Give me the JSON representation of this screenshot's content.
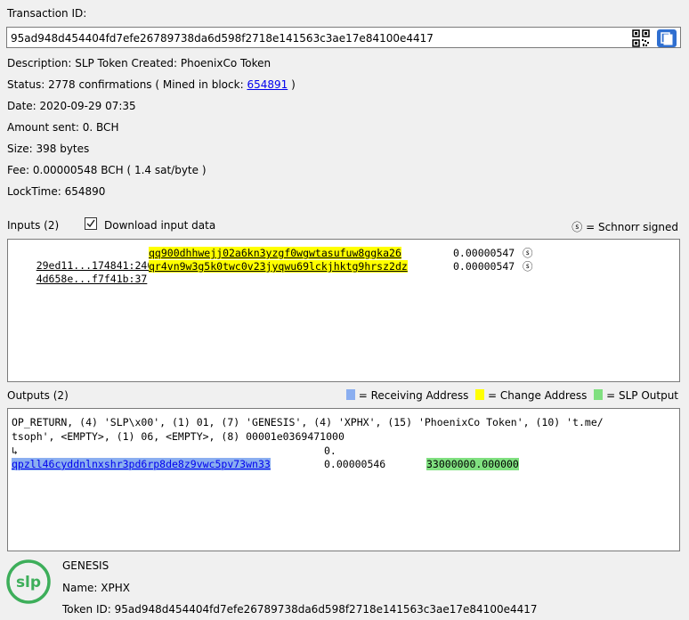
{
  "transaction": {
    "id_label": "Transaction ID:",
    "id_value": "95ad948d454404fd7efe26789738da6d598f2718e141563c3ae17e84100e4417",
    "description": "Description: SLP Token Created: PhoenixCo Token",
    "status_prefix": "Status: 2778 confirmations ( Mined in block: ",
    "block_link": "654891",
    "status_suffix": " )",
    "date": "Date: 2020-09-29 07:35",
    "amount": "Amount sent: 0. BCH",
    "size": "Size: 398 bytes",
    "fee": "Fee: 0.00000548 BCH ( 1.4 sat/byte )",
    "locktime": "LockTime: 654890"
  },
  "inputs": {
    "title": "Inputs (2)",
    "download_label": "Download input data",
    "download_checked": true,
    "schnorr_legend": "= Schnorr signed",
    "schnorr_symbol": "ⓢ",
    "rows": [
      {
        "outpoint": "29ed11...174841:240",
        "address": "qq900dhhwejj02a6kn3yzgf0wgwtasufuw8ggka26",
        "amount": "0.00000547",
        "sig": "ⓢ"
      },
      {
        "outpoint": "4d658e...f7f41b:37",
        "address": "qr4vn9w3g5k0twc0v23jyqwu69lckjhktg9hrsz2dz",
        "amount": "0.00000547",
        "sig": "ⓢ"
      }
    ]
  },
  "outputs": {
    "title": "Outputs (2)",
    "legend_receiving": "= Receiving Address",
    "legend_change": "= Change Address",
    "legend_slp": "= SLP Output",
    "op_return_line1": "OP_RETURN, (4) 'SLP\\x00', (1) 01, (7) 'GENESIS', (4) 'XPHX', (15) 'PhoenixCo Token', (10) 't.me/",
    "op_return_line2": "tsoph', <EMPTY>, (1) 06, <EMPTY>, (8) 00001e0369471000",
    "op_return_line3_symbol": "↳",
    "op_return_amount": "0.",
    "address": "qpzll46cyddnlnxshr3pd6rp8de8z9vwc5pv73wn33",
    "amount": "0.00000546",
    "slp_amount": "33000000.000000"
  },
  "token": {
    "logo_text": "slp",
    "type": "GENESIS",
    "name": "Name: XPHX",
    "token_id": "Token ID: 95ad948d454404fd7efe26789738da6d598f2718e141563c3ae17e84100e4417"
  },
  "colors": {
    "receiving": "#8aaef0",
    "change": "#ffff00",
    "slp": "#80e080",
    "logo_green": "#3dae5a"
  }
}
